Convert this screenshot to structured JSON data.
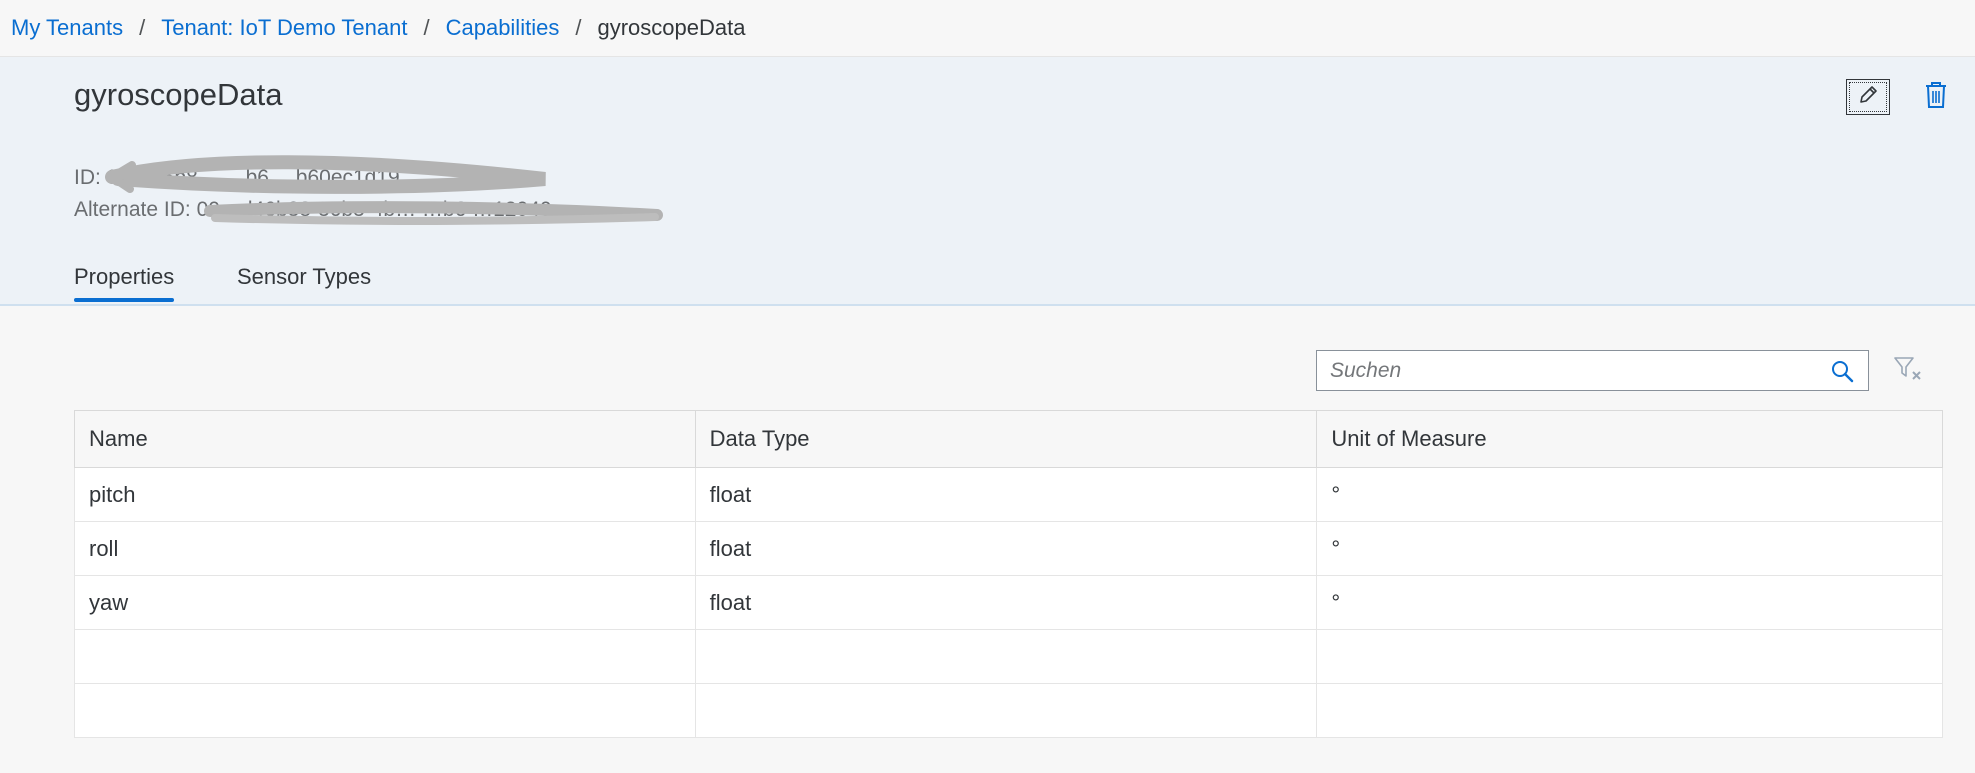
{
  "breadcrumb": {
    "items": [
      "My Tenants",
      "Tenant: IoT Demo Tenant",
      "Capabilities"
    ],
    "current": "gyroscopeData",
    "separator": "/"
  },
  "header": {
    "title": "gyroscopeData",
    "id_label": "ID:",
    "id_value": "0…d46b8… …b6 …b60ec1d19…",
    "alt_id_label": "Alternate ID:",
    "alt_id_value": "00…d46b38-36b3-4b… …b6 …12040"
  },
  "tabs": [
    {
      "label": "Properties",
      "active": true
    },
    {
      "label": "Sensor Types",
      "active": false
    }
  ],
  "search": {
    "placeholder": "Suchen"
  },
  "table": {
    "columns": [
      "Name",
      "Data Type",
      "Unit of Measure"
    ],
    "rows": [
      [
        "pitch",
        "float",
        "°"
      ],
      [
        "roll",
        "float",
        "°"
      ],
      [
        "yaw",
        "float",
        "°"
      ]
    ]
  },
  "colors": {
    "accent": "#0a6ed1",
    "header_bg": "#edf2f7"
  },
  "icons": {
    "edit": "pencil-icon",
    "delete": "trash-icon",
    "search": "search-icon",
    "filter": "clear-filter-icon"
  }
}
